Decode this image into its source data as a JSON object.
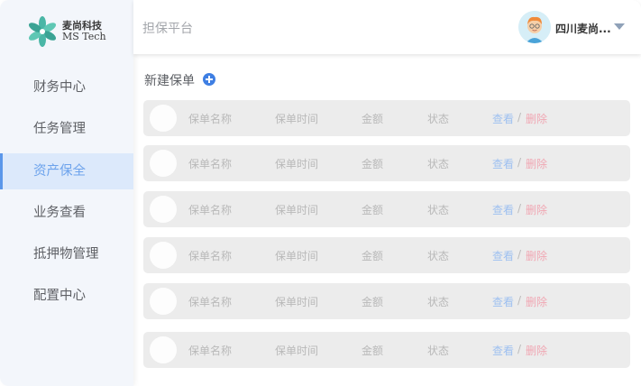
{
  "logo": {
    "cn": "麦尚科技",
    "en": "MS Tech"
  },
  "sidebar": {
    "items": [
      {
        "label": "财务中心"
      },
      {
        "label": "任务管理"
      },
      {
        "label": "资产保全"
      },
      {
        "label": "业务查看"
      },
      {
        "label": "抵押物管理"
      },
      {
        "label": "配置中心"
      }
    ],
    "active_index": 2
  },
  "header": {
    "title": "担保平台",
    "user_name": "四川麦尚...",
    "avatar_icon": "user-avatar-icon",
    "dropdown_icon": "caret-down-icon"
  },
  "main": {
    "section_title": "新建保单",
    "add_icon": "plus-circle-icon",
    "rows": [
      {
        "name": "保单名称",
        "time": "保单时间",
        "amount": "金额",
        "status": "状态",
        "view": "查看",
        "sep": "/",
        "delete": "删除"
      },
      {
        "name": "保单名称",
        "time": "保单时间",
        "amount": "金额",
        "status": "状态",
        "view": "查看",
        "sep": "/",
        "delete": "删除"
      },
      {
        "name": "保单名称",
        "time": "保单时间",
        "amount": "金额",
        "status": "状态",
        "view": "查看",
        "sep": "/",
        "delete": "删除"
      },
      {
        "name": "保单名称",
        "time": "保单时间",
        "amount": "金额",
        "status": "状态",
        "view": "查看",
        "sep": "/",
        "delete": "删除"
      },
      {
        "name": "保单名称",
        "time": "保单时间",
        "amount": "金额",
        "status": "状态",
        "view": "查看",
        "sep": "/",
        "delete": "删除"
      },
      {
        "name": "保单名称",
        "time": "保单时间",
        "amount": "金额",
        "status": "状态",
        "view": "查看",
        "sep": "/",
        "delete": "删除"
      }
    ]
  },
  "colors": {
    "accent": "#5b97ea",
    "active_bg": "#dce9fb",
    "view_link": "#9ec0f0",
    "delete_link": "#f0a7b3",
    "row_bg": "#ececec"
  }
}
